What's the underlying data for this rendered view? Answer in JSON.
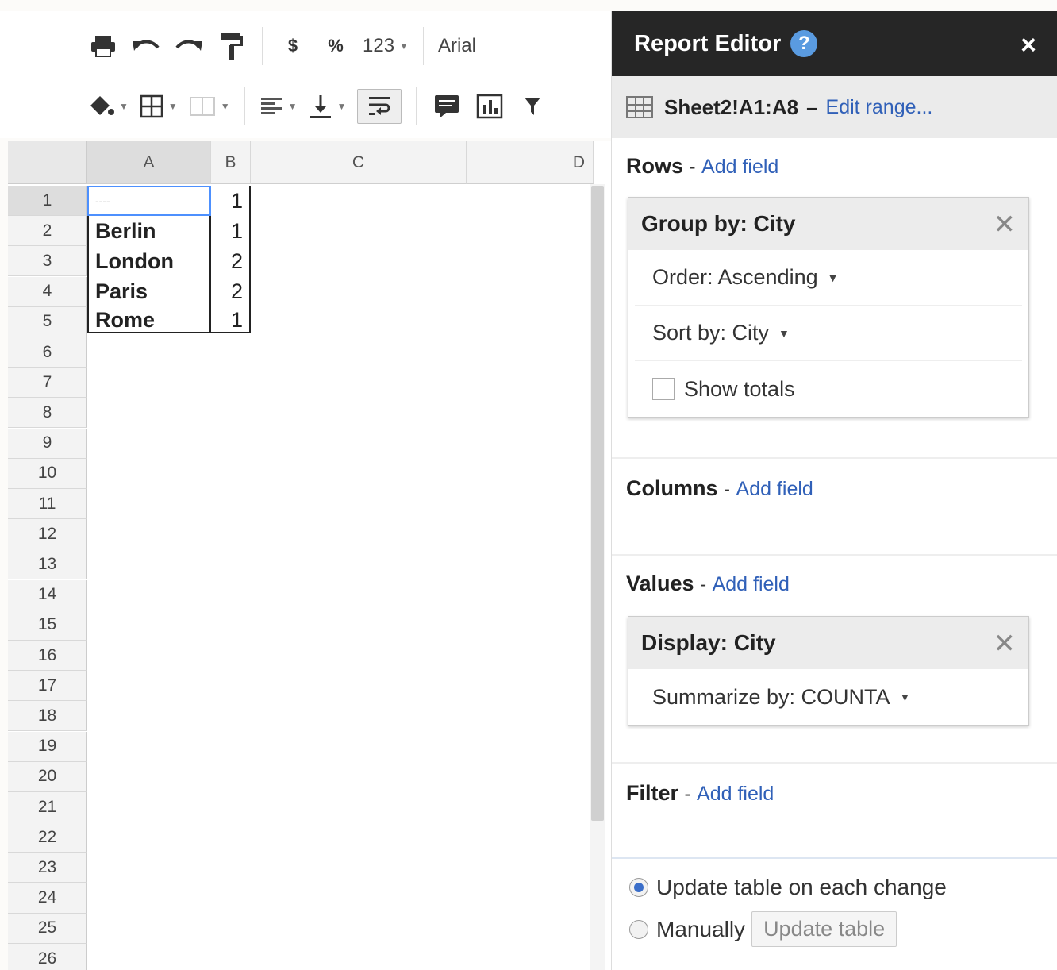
{
  "toolbar": {
    "currency_label": "$",
    "percent_label": "%",
    "number_format_label": "123",
    "font_name": "Arial"
  },
  "grid": {
    "columns": [
      "A",
      "B",
      "C",
      "D"
    ],
    "row_numbers": [
      "1",
      "2",
      "3",
      "4",
      "5",
      "6",
      "7",
      "8",
      "9",
      "10",
      "11",
      "12",
      "13",
      "14",
      "15",
      "16",
      "17",
      "18",
      "19",
      "20",
      "21",
      "22",
      "23",
      "24",
      "25",
      "26"
    ],
    "cells": [
      {
        "a": "----",
        "b": "1"
      },
      {
        "a": "Berlin",
        "b": "1"
      },
      {
        "a": "London",
        "b": "2"
      },
      {
        "a": "Paris",
        "b": "2"
      },
      {
        "a": "Rome",
        "b": "1"
      }
    ]
  },
  "panel": {
    "title": "Report Editor",
    "help": "?",
    "close": "×",
    "range": "Sheet2!A1:A8",
    "range_dash": "–",
    "edit_range": "Edit range...",
    "rows": {
      "title": "Rows",
      "sep": "-",
      "add": "Add field",
      "card_title": "Group by: City",
      "order_label": "Order: Ascending",
      "sort_label": "Sort by: City",
      "show_totals": "Show totals"
    },
    "columns": {
      "title": "Columns",
      "sep": "-",
      "add": "Add field"
    },
    "values": {
      "title": "Values",
      "sep": "-",
      "add": "Add field",
      "card_title": "Display: City",
      "summarize_label": "Summarize by: COUNTA"
    },
    "filter": {
      "title": "Filter",
      "sep": "-",
      "add": "Add field"
    },
    "update": {
      "auto_label": "Update table on each change",
      "manual_label": "Manually",
      "button": "Update table"
    }
  }
}
